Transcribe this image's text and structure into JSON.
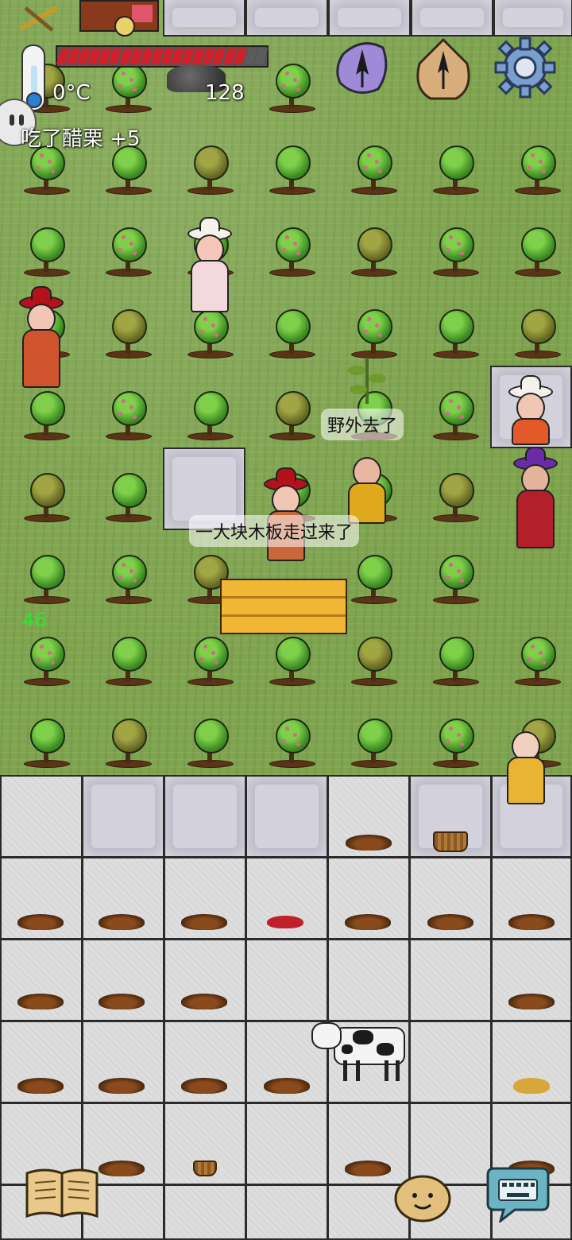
{
  "hud": {
    "temperature": "0°C",
    "food_value": "128",
    "food_fill": 0.9,
    "status_message": "吃了醋栗 +5",
    "age": "46"
  },
  "speech": {
    "bubble_1": "野外去了",
    "bubble_2": "一大块木板走过来了"
  },
  "icons": {
    "thermometer": "thermometer-icon",
    "north_compass": "compass-north-icon",
    "home_marker": "home-direction-icon",
    "settings": "gear-icon",
    "tech_book": "recipe-book-icon",
    "emote": "emote-face-icon",
    "keyboard": "keyboard-chat-icon",
    "held_tool": "crossed-tools-icon",
    "cart": "handcart-icon"
  },
  "colors": {
    "food_bar": "#d2202a",
    "grass": "#7fa44f",
    "status_text": "#ffffff",
    "age_text": "#2ee82e"
  }
}
